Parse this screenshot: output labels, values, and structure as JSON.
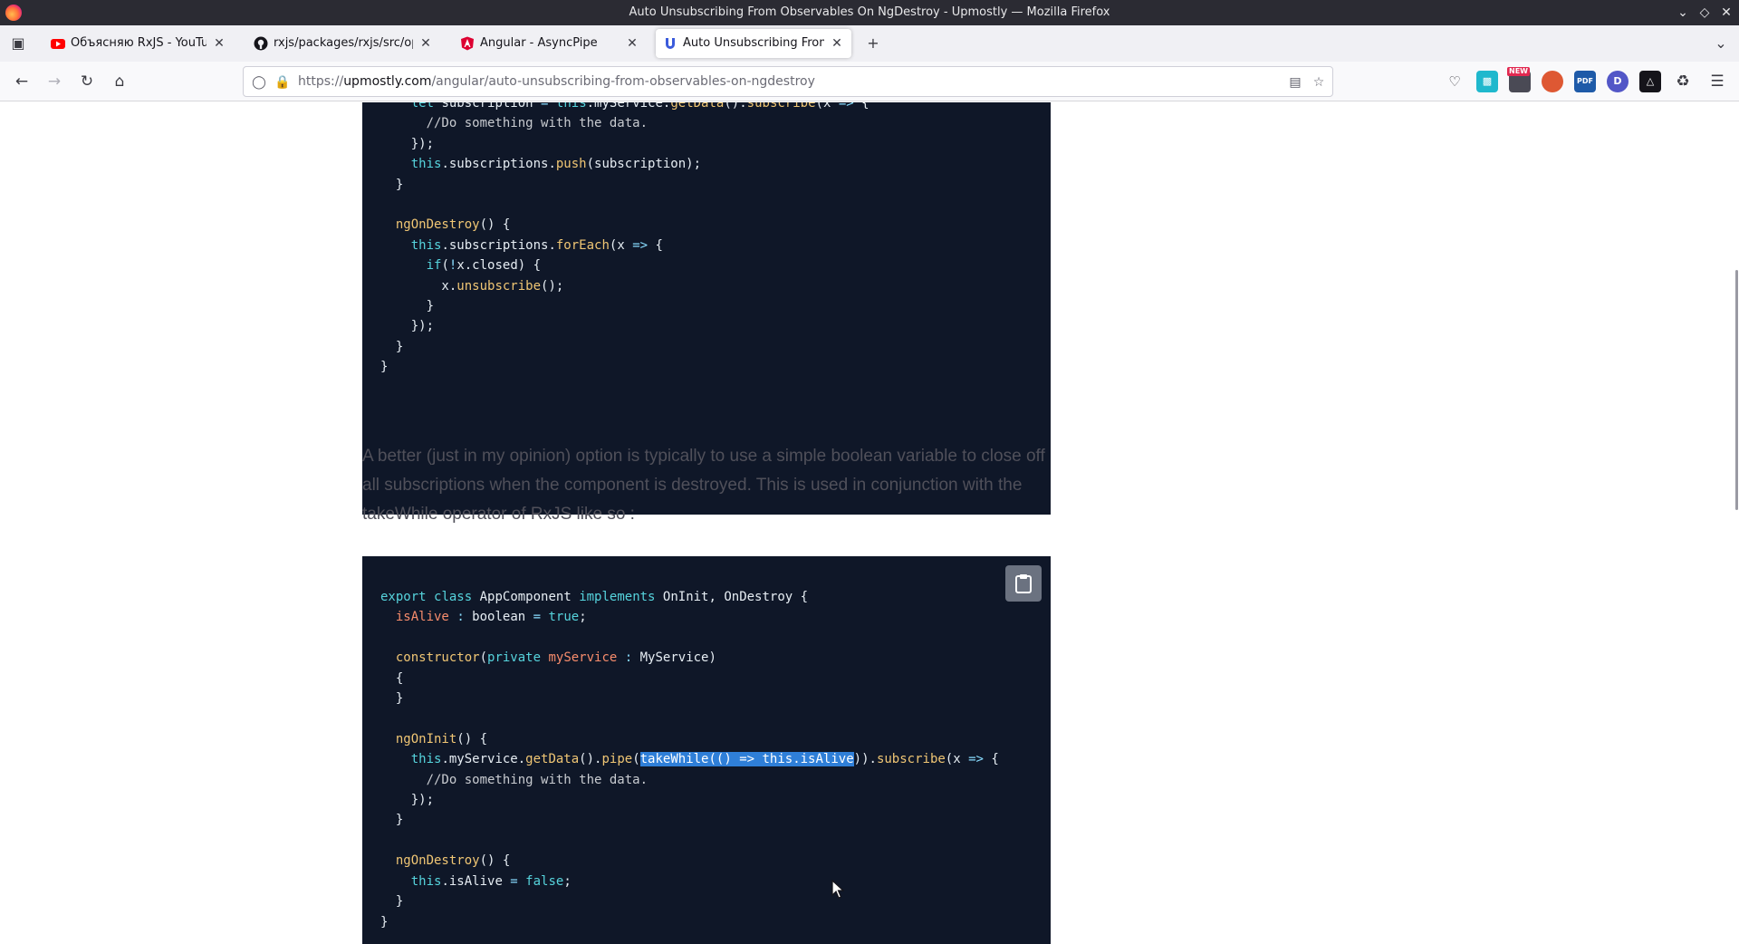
{
  "window": {
    "title": "Auto Unsubscribing From Observables On NgDestroy - Upmostly — Mozilla Firefox"
  },
  "tabs": [
    {
      "label": "Объясняю RxJS - YouTube",
      "favicon": "youtube-icon"
    },
    {
      "label": "rxjs/packages/rxjs/src/ope",
      "favicon": "github-icon"
    },
    {
      "label": "Angular - AsyncPipe",
      "favicon": "angular-icon"
    },
    {
      "label": "Auto Unsubscribing From O",
      "favicon": "upmostly-icon",
      "active": true
    }
  ],
  "navbar": {
    "url_prefix": "https://",
    "url_host": "upmostly.com",
    "url_path": "/angular/auto-unsubscribing-from-observables-on-ngdestroy"
  },
  "extensions": {
    "new_badge": "NEW",
    "pdf_label": "PDF",
    "d_label": "D"
  },
  "article": {
    "paragraph": "A better (just in my opinion) option is typically to use a simple boolean variable to close off all subscriptions when the component is destroyed. This is used in conjunction with the takeWhile operator of RxJS like so :"
  },
  "colors": {
    "code_bg": "#0f1728",
    "selection": "#2f7fd8",
    "keyword": "#56d4dd",
    "function": "#f0c674",
    "property": "#f78c6c"
  }
}
